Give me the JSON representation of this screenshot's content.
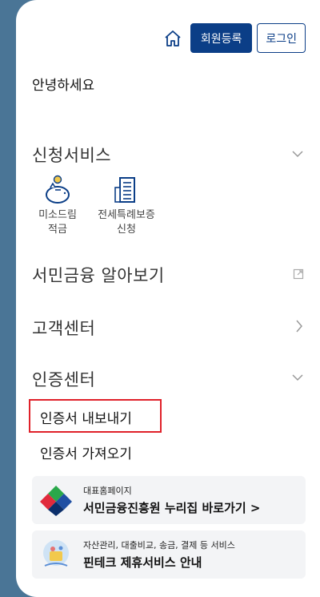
{
  "header": {
    "register_label": "회원등록",
    "login_label": "로그인"
  },
  "greeting": "안녕하세요",
  "sections": {
    "apply": {
      "title": "신청서비스"
    },
    "learn": {
      "title": "서민금융 알아보기"
    },
    "support": {
      "title": "고객센터"
    },
    "cert": {
      "title": "인증센터"
    }
  },
  "services": [
    {
      "line1": "미소드림",
      "line2": "적금"
    },
    {
      "line1": "전세특례보증",
      "line2": "신청"
    }
  ],
  "cert_items": {
    "export": "인증서 내보내기",
    "import": "인증서 가져오기"
  },
  "banners": [
    {
      "small": "대표홈페이지",
      "big": "서민금융진흥원 누리집 바로가기 >"
    },
    {
      "small": "자산관리, 대출비교, 송금, 결제 등 서비스",
      "big": "핀테크 제휴서비스 안내"
    }
  ],
  "colors": {
    "background": "#4a7596",
    "primary": "#0b3e87",
    "highlight_border": "#e0212a"
  },
  "icons": {
    "home": "home-icon",
    "chevron_down": "chevron-down-icon",
    "chevron_right": "chevron-right-icon",
    "external_link": "external-link-icon",
    "piggy_bank": "piggy-bank-icon",
    "building": "building-icon"
  }
}
